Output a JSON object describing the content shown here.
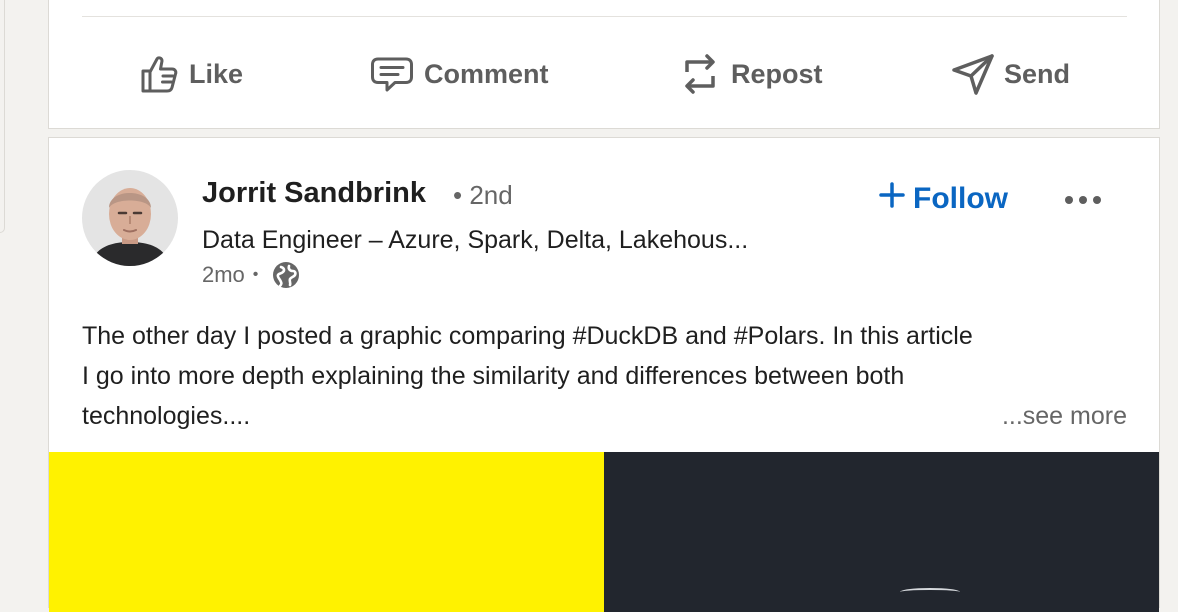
{
  "actions": {
    "like": "Like",
    "comment": "Comment",
    "repost": "Repost",
    "send": "Send"
  },
  "post": {
    "author": {
      "name": "Jorrit Sandbrink",
      "degree": "• 2nd",
      "headline": "Data Engineer – Azure, Spark, Delta, Lakehous...",
      "age": "2mo",
      "age_separator": "•",
      "visibility_icon": "globe-icon"
    },
    "follow_label": "Follow",
    "text_lines": [
      "The other day I posted a graphic comparing #DuckDB and #Polars. In this article",
      "I go into more depth explaining the similarity and differences between both",
      "technologies...."
    ],
    "see_more": "...see more",
    "media": {
      "left_color": "#fff200",
      "right_color": "#22262e"
    }
  },
  "colors": {
    "accent": "#0a66c2",
    "text": "#1f1f1f",
    "muted": "#666666",
    "background": "#f3f2ef"
  }
}
